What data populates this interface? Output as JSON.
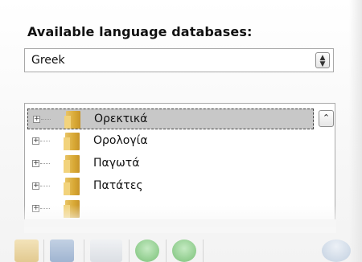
{
  "section": {
    "title": "Available language databases:"
  },
  "language_select": {
    "selected": "Greek",
    "button_icon": "up-down-arrows-icon"
  },
  "tree": {
    "items": [
      {
        "label": "Ορεκτικά",
        "selected": true
      },
      {
        "label": "Ορολογία",
        "selected": false
      },
      {
        "label": "Παγωτά",
        "selected": false
      },
      {
        "label": "Πατάτες",
        "selected": false
      },
      {
        "label": "",
        "selected": false
      }
    ],
    "expander_glyph": "+",
    "scroll_up_glyph": "⌃"
  },
  "toolbar": {
    "icons": [
      "folder-icon",
      "database-icon",
      "list-check-icon",
      "add-icon",
      "confirm-icon",
      "help-icon"
    ]
  },
  "colors": {
    "selection": "#c8c8c8",
    "folder": "#d9a935"
  }
}
